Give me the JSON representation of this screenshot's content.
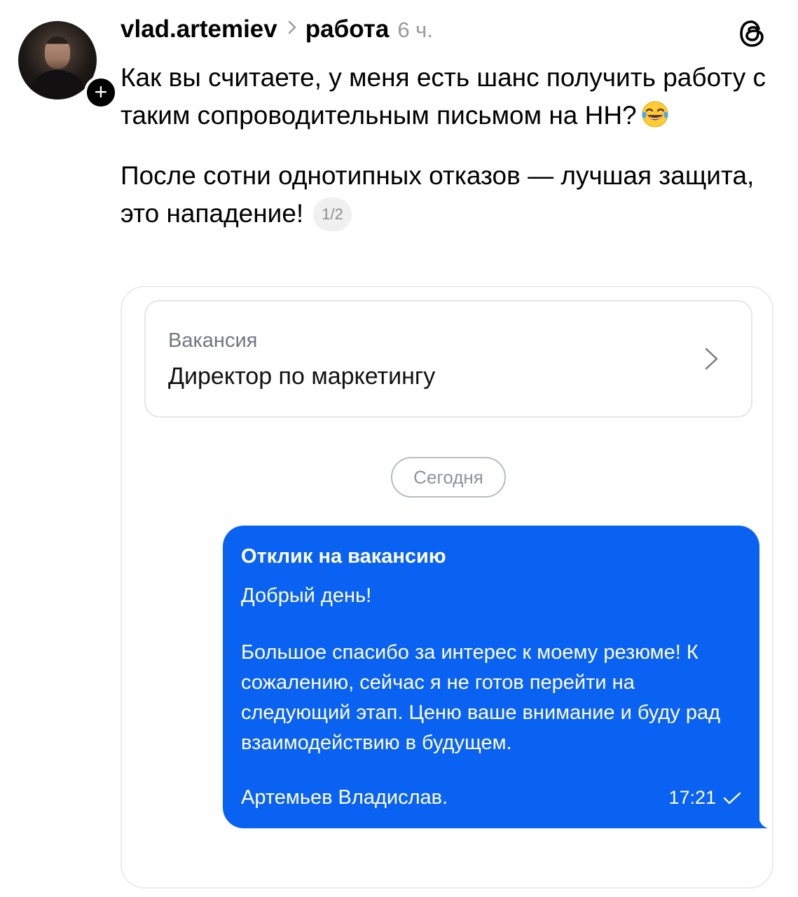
{
  "post": {
    "author": "vlad.artemiev",
    "separator_icon": "chevron-right-icon",
    "topic": "работа",
    "time": "6 ч.",
    "follow_icon": "plus-icon",
    "app_icon": "threads-logo-icon",
    "text_line1": "Как вы считаете, у меня есть шанс получить работу с таким сопроводительным письмом на НН?",
    "emoji": "face-with-tears-of-joy-emoji",
    "text_line2": "После сотни однотипных отказов — лучшая защита, это нападение!",
    "media_counter": "1/2"
  },
  "screenshot": {
    "vacancy": {
      "label": "Вакансия",
      "title": "Директор по маркетингу",
      "chevron_icon": "chevron-right-icon"
    },
    "date_pill": "Сегодня",
    "message": {
      "heading": "Отклик на вакансию",
      "greeting": "Добрый день!",
      "body": "Большое спасибо за интерес к моему резюме! К сожалению, сейчас я не готов перейти на следующий этап. Ценю ваше внимание и буду рад взаимодействию в будущем.",
      "signature": "Артемьев Владислав.",
      "time": "17:21",
      "status_icon": "checkmark-icon",
      "bubble_color": "#0a62f2"
    }
  }
}
